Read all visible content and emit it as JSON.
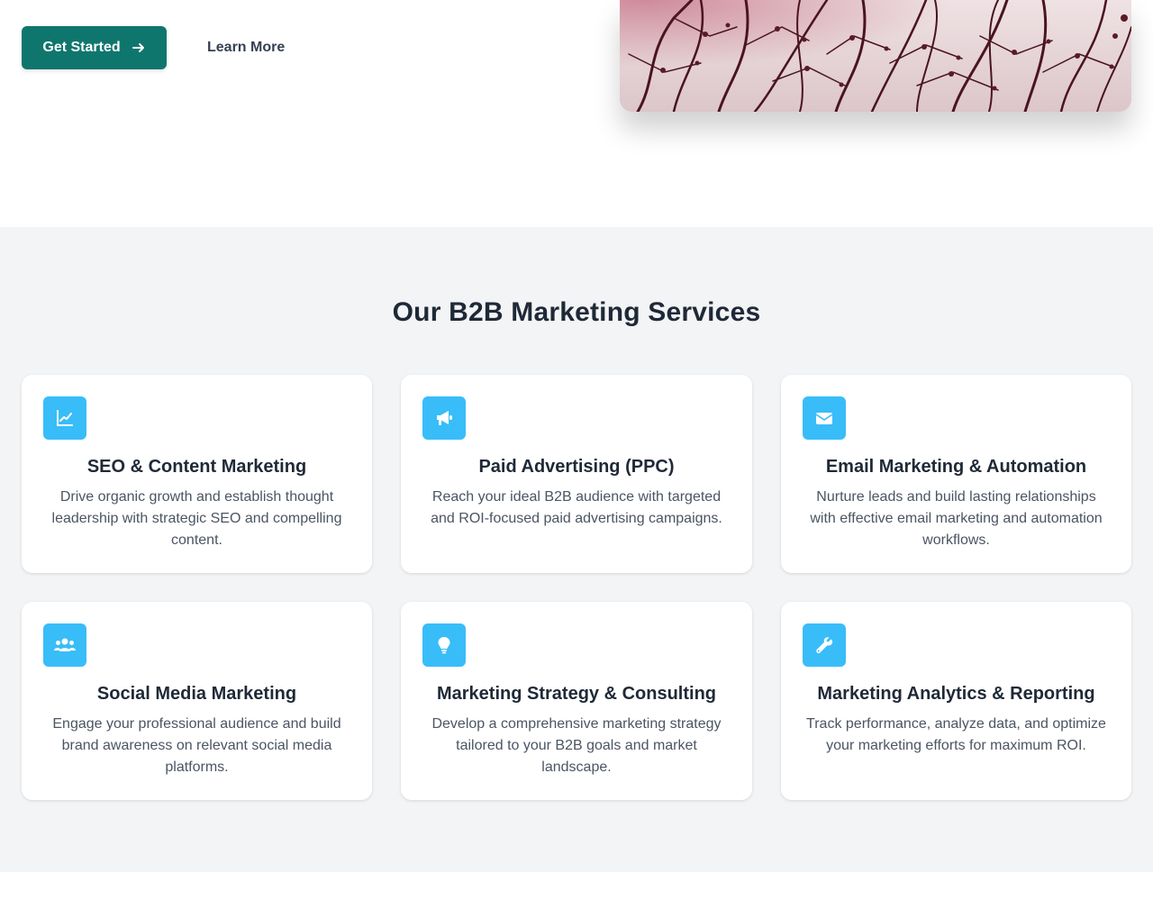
{
  "hero": {
    "primary_button": "Get Started",
    "secondary_button": "Learn More"
  },
  "services": {
    "title": "Our B2B Marketing Services",
    "cards": [
      {
        "icon": "chart-line-icon",
        "title": "SEO & Content Marketing",
        "text": "Drive organic growth and establish thought leadership with strategic SEO and compelling content."
      },
      {
        "icon": "bullhorn-icon",
        "title": "Paid Advertising (PPC)",
        "text": "Reach your ideal B2B audience with targeted and ROI-focused paid advertising campaigns."
      },
      {
        "icon": "envelope-icon",
        "title": "Email Marketing & Automation",
        "text": "Nurture leads and build lasting relationships with effective email marketing and automation workflows."
      },
      {
        "icon": "users-icon",
        "title": "Social Media Marketing",
        "text": "Engage your professional audience and build brand awareness on relevant social media platforms."
      },
      {
        "icon": "lightbulb-icon",
        "title": "Marketing Strategy & Consulting",
        "text": "Develop a comprehensive marketing strategy tailored to your B2B goals and market landscape."
      },
      {
        "icon": "wrench-icon",
        "title": "Marketing Analytics & Reporting",
        "text": "Track performance, analyze data, and optimize your marketing efforts for maximum ROI."
      }
    ]
  },
  "colors": {
    "primary": "#0f766e",
    "accent_icon_bg": "#38bdf8",
    "section_bg": "#f3f4f6",
    "heading": "#1f2937",
    "body_text": "#4b5563"
  }
}
